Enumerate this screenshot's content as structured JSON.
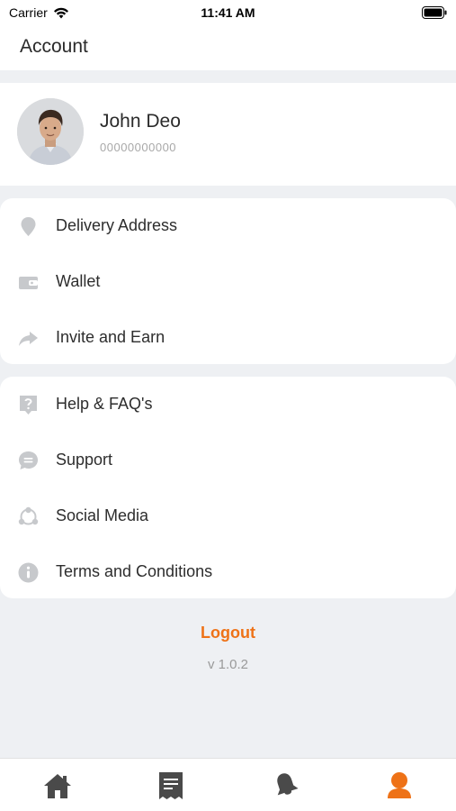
{
  "status_bar": {
    "carrier": "Carrier",
    "time": "11:41 AM"
  },
  "header": {
    "title": "Account"
  },
  "profile": {
    "name": "John Deo",
    "phone": "00000000000"
  },
  "menu_group_1": [
    {
      "label": "Delivery Address",
      "icon": "location-pin-icon"
    },
    {
      "label": "Wallet",
      "icon": "wallet-icon"
    },
    {
      "label": "Invite and Earn",
      "icon": "share-arrow-icon"
    }
  ],
  "menu_group_2": [
    {
      "label": "Help & FAQ's",
      "icon": "help-icon"
    },
    {
      "label": "Support",
      "icon": "chat-bubble-icon"
    },
    {
      "label": "Social Media",
      "icon": "social-network-icon"
    },
    {
      "label": "Terms and Conditions",
      "icon": "info-icon"
    }
  ],
  "footer": {
    "logout_label": "Logout",
    "version": "v 1.0.2"
  },
  "tabbar": {
    "items": [
      "home-icon",
      "receipt-icon",
      "bell-icon",
      "account-icon"
    ],
    "active": "account"
  },
  "colors": {
    "accent": "#ee7217",
    "icon_gray": "#c7c9cc",
    "tab_gray": "#4a4a4a",
    "background": "#eef0f3"
  }
}
